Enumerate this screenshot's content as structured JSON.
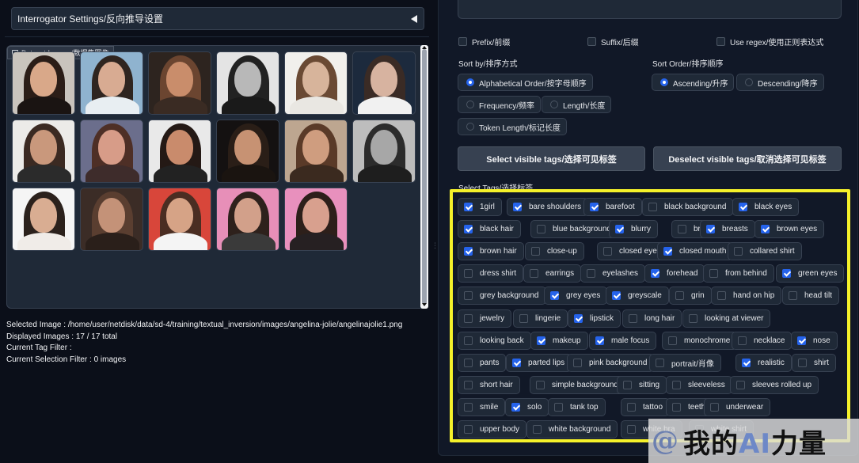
{
  "interrogator": {
    "title": "Interrogator Settings/反向推导设置"
  },
  "gallery": {
    "label": "Dataset Images/数据集图像",
    "thumbnails": [
      {
        "bg": "#c9c4bd",
        "hair": "#2b1d17",
        "skin": "#d9a889",
        "body": "#1a1412"
      },
      {
        "bg": "#8fb3cf",
        "hair": "#2f2520",
        "skin": "#d8ab92",
        "body": "#e8eef2"
      },
      {
        "bg": "#2d241f",
        "hair": "#6b4530",
        "skin": "#c98d6b",
        "body": "#3a2b23"
      },
      {
        "bg": "#e4e4e4",
        "hair": "#222222",
        "skin": "#b8b8b8",
        "body": "#1a1a1a"
      },
      {
        "bg": "#f1f0ec",
        "hair": "#6a4a34",
        "skin": "#d7b49b",
        "body": "#e9e7e2"
      },
      {
        "bg": "#1c2a3d",
        "hair": "#3a2b25",
        "skin": "#d7b3a0",
        "body": "#f1f1f1"
      },
      {
        "bg": "#ecebe8",
        "hair": "#3b2a22",
        "skin": "#c9987c",
        "body": "#2b2b2b"
      },
      {
        "bg": "#6b6e8c",
        "hair": "#4e2f26",
        "skin": "#d79c88",
        "body": "#3e2c2b"
      },
      {
        "bg": "#e9e9e9",
        "hair": "#241915",
        "skin": "#c98b6c",
        "body": "#222222"
      },
      {
        "bg": "#141111",
        "hair": "#2a1e17",
        "skin": "#c79273",
        "body": "#1a1410"
      },
      {
        "bg": "#bda690",
        "hair": "#5a3a28",
        "skin": "#cf9d7f",
        "body": "#3b2a1f"
      },
      {
        "bg": "#bdbdbd",
        "hair": "#2c2c2c",
        "skin": "#a7a7a7",
        "body": "#1e1e1e"
      },
      {
        "bg": "#f5f5f5",
        "hair": "#2b211c",
        "skin": "#d9ad92",
        "body": "#f0ece8"
      },
      {
        "bg": "#3b2c26",
        "hair": "#5a3e30",
        "skin": "#c49278",
        "body": "#2a1f1a"
      },
      {
        "bg": "#d8463a",
        "hair": "#4a2d22",
        "skin": "#d6a386",
        "body": "#f4f4f4"
      },
      {
        "bg": "#e78fb8",
        "hair": "#2e211c",
        "skin": "#d2a08a",
        "body": "#3a3a3a"
      },
      {
        "bg": "#e890bd",
        "hair": "#2d1f1a",
        "skin": "#d8a08e",
        "body": "#262022"
      }
    ]
  },
  "info": {
    "selected_image": "Selected Image : /home/user/netdisk/data/sd-4/training/textual_inversion/images/angelina-jolie/angelinajolie1.png",
    "displayed": "Displayed Images : 17 / 17 total",
    "tag_filter": "Current Tag Filter :",
    "selection_filter": "Current Selection Filter : 0 images"
  },
  "options": {
    "prefix": "Prefix/前缀",
    "suffix": "Suffix/后缀",
    "regex": "Use regex/使用正则表达式"
  },
  "sort_by": {
    "label": "Sort by/排序方式",
    "choices": [
      "Alphabetical Order/按字母顺序",
      "Frequency/频率",
      "Length/长度",
      "Token Length/标记长度"
    ],
    "selected": "Alphabetical Order/按字母顺序"
  },
  "sort_order": {
    "label": "Sort Order/排序顺序",
    "choices": [
      "Ascending/升序",
      "Descending/降序"
    ],
    "selected": "Ascending/升序"
  },
  "buttons": {
    "select_visible": "Select visible tags/选择可见标签",
    "deselect_visible": "Deselect visible tags/取消选择可见标签"
  },
  "select_tags": {
    "label": "Select Tags/选择标签",
    "rows": [
      [
        [
          "1girl",
          true
        ],
        [
          "bare shoulders",
          true
        ],
        [
          "barefoot",
          true
        ],
        [
          "black background",
          false
        ],
        [
          "black eyes",
          true
        ]
      ],
      [
        [
          "black hair",
          true
        ],
        [
          "blue background",
          false
        ],
        [
          "blurry",
          true
        ],
        [
          "bra",
          false
        ],
        [
          "breasts",
          true
        ],
        [
          "brown eyes",
          true
        ]
      ],
      [
        [
          "brown hair",
          true
        ],
        [
          "close-up",
          false
        ],
        [
          "closed eyes",
          false
        ],
        [
          "closed mouth",
          true
        ],
        [
          "collared shirt",
          false
        ]
      ],
      [
        [
          "dress shirt",
          false
        ],
        [
          "earrings",
          false
        ],
        [
          "eyelashes",
          false
        ],
        [
          "forehead",
          true
        ],
        [
          "from behind",
          false
        ],
        [
          "green eyes",
          true
        ]
      ],
      [
        [
          "grey background",
          false
        ],
        [
          "grey eyes",
          true
        ],
        [
          "greyscale",
          true
        ],
        [
          "grin",
          false
        ],
        [
          "hand on hip",
          false
        ],
        [
          "head tilt",
          false
        ]
      ],
      [
        [
          "jewelry",
          false
        ],
        [
          "lingerie",
          false
        ],
        [
          "lipstick",
          true
        ],
        [
          "long hair",
          false
        ],
        [
          "looking at viewer",
          false
        ]
      ],
      [
        [
          "looking back",
          false
        ],
        [
          "makeup",
          true
        ],
        [
          "male focus",
          true
        ],
        [
          "monochrome",
          false
        ],
        [
          "necklace",
          false
        ],
        [
          "nose",
          true
        ]
      ],
      [
        [
          "pants",
          false
        ],
        [
          "parted lips",
          true
        ],
        [
          "pink background",
          false
        ],
        [
          "portrait/肖像",
          false
        ],
        [
          "realistic",
          true
        ],
        [
          "shirt",
          false
        ]
      ],
      [
        [
          "short hair",
          false
        ],
        [
          "simple background",
          false
        ],
        [
          "sitting",
          false
        ],
        [
          "sleeveless",
          false
        ],
        [
          "sleeves rolled up",
          false
        ]
      ],
      [
        [
          "smile",
          false
        ],
        [
          "solo",
          true
        ],
        [
          "tank top",
          false
        ],
        [
          "tattoo",
          false
        ],
        [
          "teeth",
          false
        ],
        [
          "underwear",
          false
        ]
      ],
      [
        [
          "upper body",
          false
        ],
        [
          "white background",
          false
        ],
        [
          "white bra",
          false
        ],
        [
          "white shirt",
          false
        ]
      ]
    ]
  },
  "watermark": {
    "at": "@",
    "prefix": "我的",
    "ai": "AI",
    "suffix": "力量"
  },
  "colors": {
    "accent": "#2563eb",
    "highlight": "#f5f12a",
    "panel": "#1f2937",
    "background": "#0b0f19"
  }
}
